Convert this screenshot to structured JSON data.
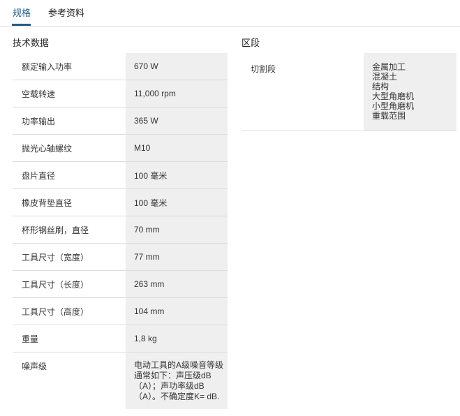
{
  "tabs": [
    "规格",
    "参考资料"
  ],
  "tech_title": "技术数据",
  "zone_title": "区段",
  "specs": [
    {
      "k": "额定输入功率",
      "v": "670 W"
    },
    {
      "k": "空载转速",
      "v": "11,000 rpm"
    },
    {
      "k": "功率输出",
      "v": "365 W"
    },
    {
      "k": "抛光心轴螺纹",
      "v": "M10"
    },
    {
      "k": "盘片直径",
      "v": "100 毫米"
    },
    {
      "k": "橡皮背垫直径",
      "v": "100 毫米"
    },
    {
      "k": "杯形钢丝刷，直径",
      "v": "70 mm"
    },
    {
      "k": "工具尺寸（宽度）",
      "v": "77 mm"
    },
    {
      "k": "工具尺寸（长度）",
      "v": "263 mm"
    },
    {
      "k": "工具尺寸（高度）",
      "v": "104 mm"
    },
    {
      "k": "重量",
      "v": "1,8 kg"
    },
    {
      "k": "噪声级",
      "v": "电动工具的A级噪音等级通常如下：声压级dB（A）；声功率级dB（A）。不确定度K= dB."
    }
  ],
  "zone": {
    "label": "切割段",
    "items": [
      "金属加工",
      "混凝土",
      "结构",
      "大型角磨机",
      "小型角磨机",
      "重载范围"
    ]
  }
}
